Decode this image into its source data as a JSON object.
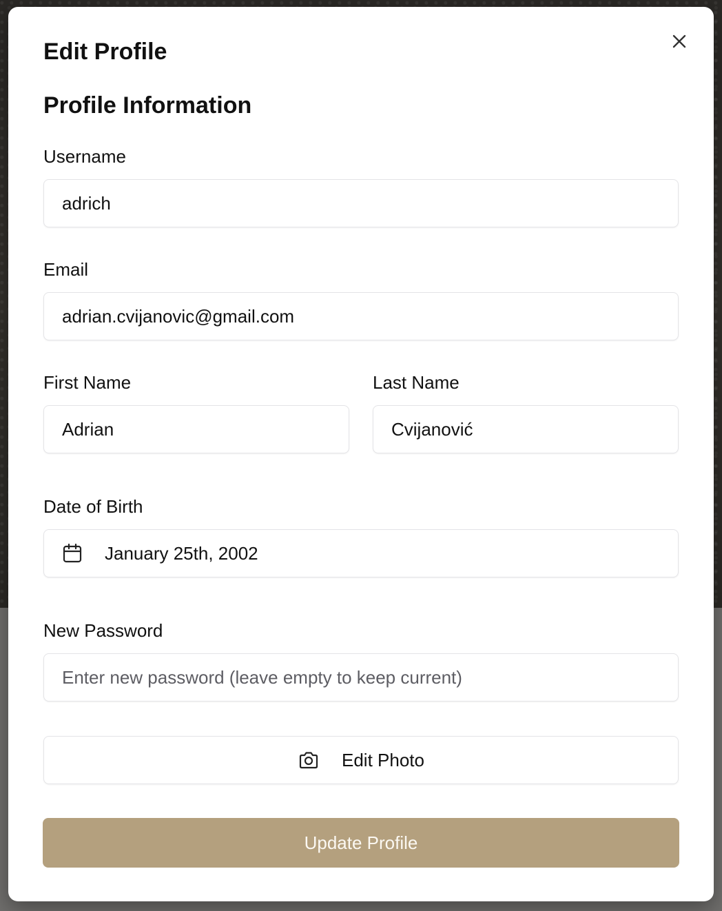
{
  "modal": {
    "title": "Edit Profile",
    "section_title": "Profile Information",
    "close_icon": "close-icon"
  },
  "form": {
    "username": {
      "label": "Username",
      "value": "adrich"
    },
    "email": {
      "label": "Email",
      "value": "adrian.cvijanovic@gmail.com"
    },
    "first_name": {
      "label": "First Name",
      "value": "Adrian"
    },
    "last_name": {
      "label": "Last Name",
      "value": "Cvijanović"
    },
    "date_of_birth": {
      "label": "Date of Birth",
      "value": "January 25th, 2002",
      "icon": "calendar-icon"
    },
    "new_password": {
      "label": "New Password",
      "value": "",
      "placeholder": "Enter new password (leave empty to keep current)"
    }
  },
  "buttons": {
    "edit_photo": {
      "label": "Edit Photo",
      "icon": "camera-icon"
    },
    "submit": {
      "label": "Update Profile"
    }
  },
  "colors": {
    "accent": "#b4a07e",
    "border": "#e4e4e7",
    "text": "#111111"
  }
}
